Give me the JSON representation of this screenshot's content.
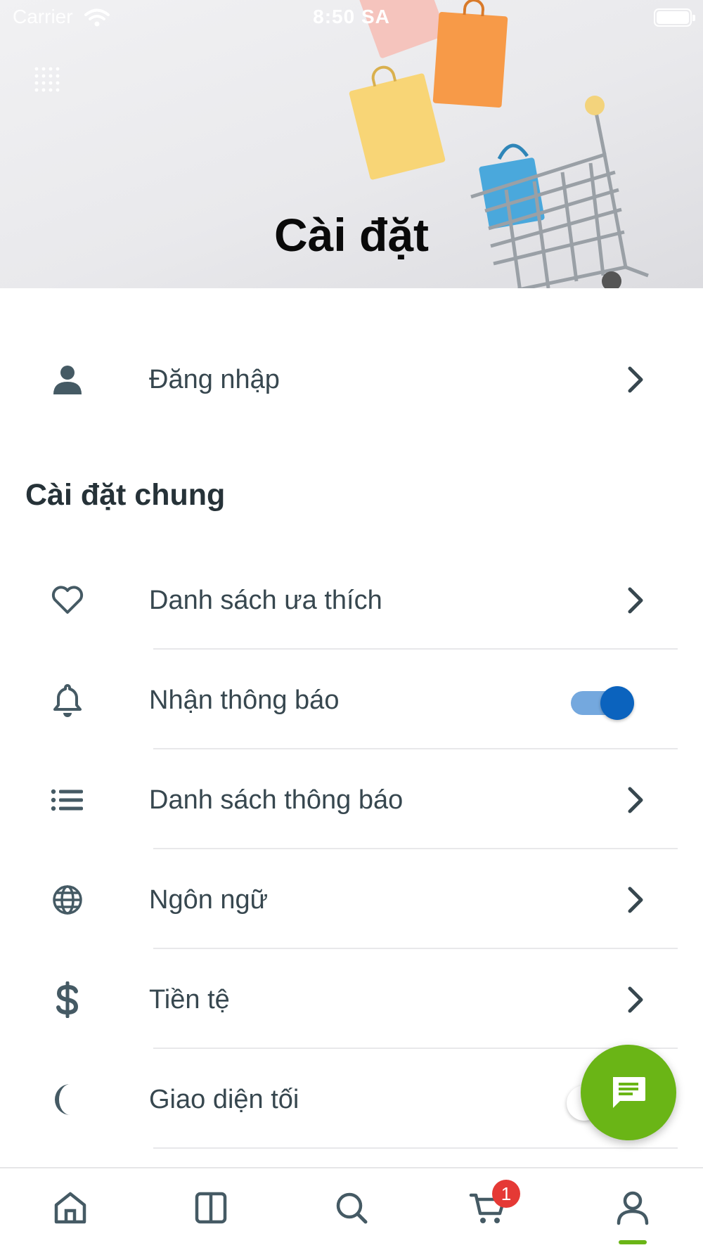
{
  "status_bar": {
    "carrier": "Carrier",
    "time": "8:50 SA"
  },
  "header": {
    "title": "Cài đặt"
  },
  "account": {
    "login_label": "Đăng nhập"
  },
  "general": {
    "section_title": "Cài đặt chung",
    "items": [
      {
        "label": "Danh sách ưa thích",
        "icon": "heart-icon",
        "control": "chevron"
      },
      {
        "label": "Nhận thông báo",
        "icon": "bell-icon",
        "control": "toggle",
        "value": true
      },
      {
        "label": "Danh sách thông báo",
        "icon": "list-icon",
        "control": "chevron"
      },
      {
        "label": "Ngôn ngữ",
        "icon": "globe-icon",
        "control": "chevron"
      },
      {
        "label": "Tiền tệ",
        "icon": "dollar-icon",
        "control": "chevron"
      },
      {
        "label": "Giao diện tối",
        "icon": "moon-icon",
        "control": "toggle",
        "value": false
      }
    ]
  },
  "tab_bar": {
    "tabs": [
      "home-icon",
      "book-icon",
      "search-icon",
      "cart-icon",
      "user-icon"
    ],
    "cart_badge": "1",
    "active_tab": "user-icon"
  },
  "colors": {
    "accent": "#6ab516",
    "toggle_on": "#0b63be",
    "badge": "#e53935",
    "text": "#37474f"
  }
}
